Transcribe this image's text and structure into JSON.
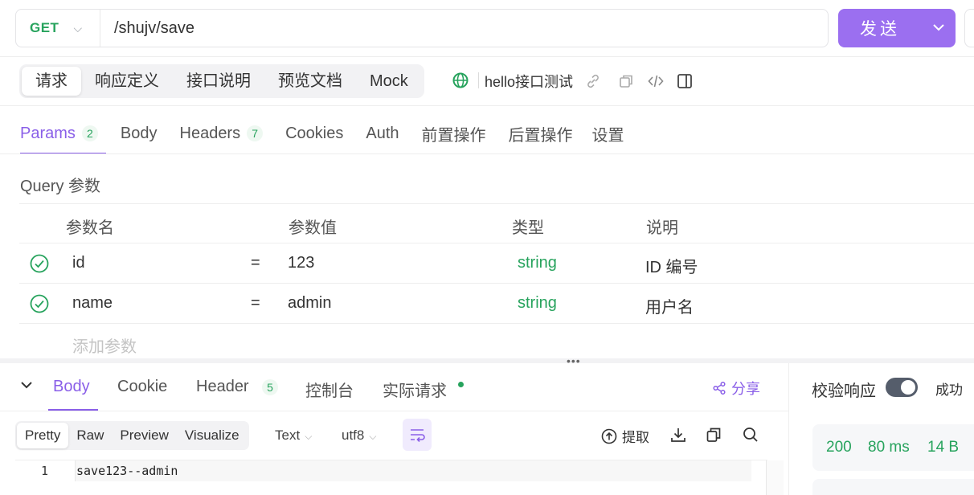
{
  "request": {
    "method": "GET",
    "url": "/shujv/save",
    "send_label": "发送"
  },
  "req_tabs": [
    "请求",
    "响应定义",
    "接口说明",
    "预览文档",
    "Mock"
  ],
  "api_name": "hello接口测试",
  "param_tabs": [
    {
      "label": "Params",
      "badge": "2"
    },
    {
      "label": "Body",
      "badge": ""
    },
    {
      "label": "Headers",
      "badge": "7"
    },
    {
      "label": "Cookies",
      "badge": ""
    },
    {
      "label": "Auth",
      "badge": ""
    },
    {
      "label": "前置操作",
      "badge": ""
    },
    {
      "label": "后置操作",
      "badge": ""
    },
    {
      "label": "设置",
      "badge": ""
    }
  ],
  "query": {
    "title": "Query 参数",
    "headers": {
      "name": "参数名",
      "value": "参数值",
      "type": "类型",
      "desc": "说明"
    },
    "rows": [
      {
        "name": "id",
        "eq": "=",
        "value": "123",
        "type": "string",
        "desc": "ID 编号"
      },
      {
        "name": "name",
        "eq": "=",
        "value": "admin",
        "type": "string",
        "desc": "用户名"
      }
    ],
    "add_placeholder": "添加参数"
  },
  "response": {
    "tabs": [
      {
        "label": "Body",
        "badge": ""
      },
      {
        "label": "Cookie",
        "badge": ""
      },
      {
        "label": "Header",
        "badge": "5"
      },
      {
        "label": "控制台",
        "badge": ""
      },
      {
        "label": "实际请求",
        "badge": ""
      }
    ],
    "share_label": "分享",
    "view_modes": [
      "Pretty",
      "Raw",
      "Preview",
      "Visualize"
    ],
    "format": "Text",
    "encoding": "utf8",
    "extract_label": "提取",
    "line_number": "1",
    "body_text": "save123--admin",
    "verify_label": "校验响应",
    "success_label": "成功",
    "status_code": "200",
    "time": "80 ms",
    "size": "14 B"
  },
  "colors": {
    "accent": "#8a5fe8",
    "send_button": "#9b6ff0",
    "success": "#27a35d"
  }
}
